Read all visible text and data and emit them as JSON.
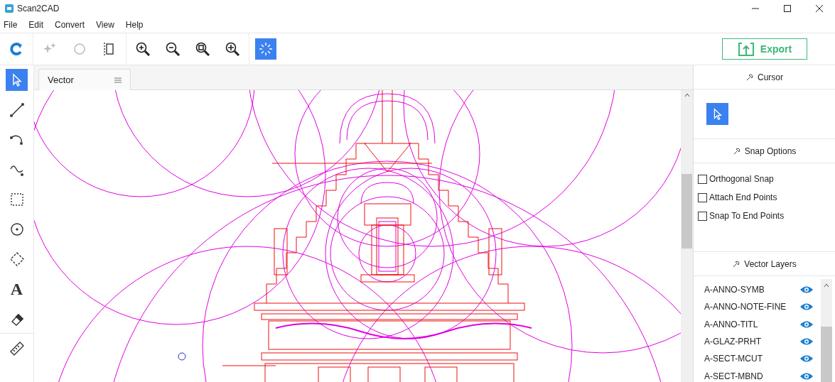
{
  "window": {
    "title": "Scan2CAD"
  },
  "menu": [
    "File",
    "Edit",
    "Convert",
    "View",
    "Help"
  ],
  "toolbar": [
    {
      "selected": false
    },
    {
      "selected": false
    },
    {
      "selected": false
    },
    {
      "selected": false
    },
    {
      "selected": false
    },
    {
      "selected": false
    },
    {
      "selected": false
    },
    {
      "selected": false
    },
    {
      "selected": true
    }
  ],
  "export_button": "Export",
  "tools": [
    {
      "selected": true
    },
    {
      "selected": false
    },
    {
      "selected": false
    },
    {
      "selected": false
    },
    {
      "selected": false
    },
    {
      "selected": false
    },
    {
      "selected": false
    },
    {
      "selected": false,
      "glyph": "A"
    },
    {
      "selected": false
    },
    {
      "selected": false
    }
  ],
  "tab": {
    "label": "Vector"
  },
  "panel": {
    "cursor": {
      "title": "Cursor",
      "selected": true
    },
    "snap_options": {
      "title": "Snap Options",
      "items": [
        {
          "label": "Orthogonal Snap",
          "checked": false
        },
        {
          "label": "Attach End Points",
          "checked": false
        },
        {
          "label": "Snap To End Points",
          "checked": false
        }
      ]
    },
    "vector_layers": {
      "title": "Vector Layers",
      "items": [
        {
          "name": "A-ANNO-SYMB",
          "visible": true
        },
        {
          "name": "A-ANNO-NOTE-FINE",
          "visible": true
        },
        {
          "name": "A-ANNO-TITL",
          "visible": true
        },
        {
          "name": "A-GLAZ-PRHT",
          "visible": true
        },
        {
          "name": "A-SECT-MCUT",
          "visible": true
        },
        {
          "name": "A-SECT-MBND",
          "visible": true
        }
      ]
    }
  }
}
